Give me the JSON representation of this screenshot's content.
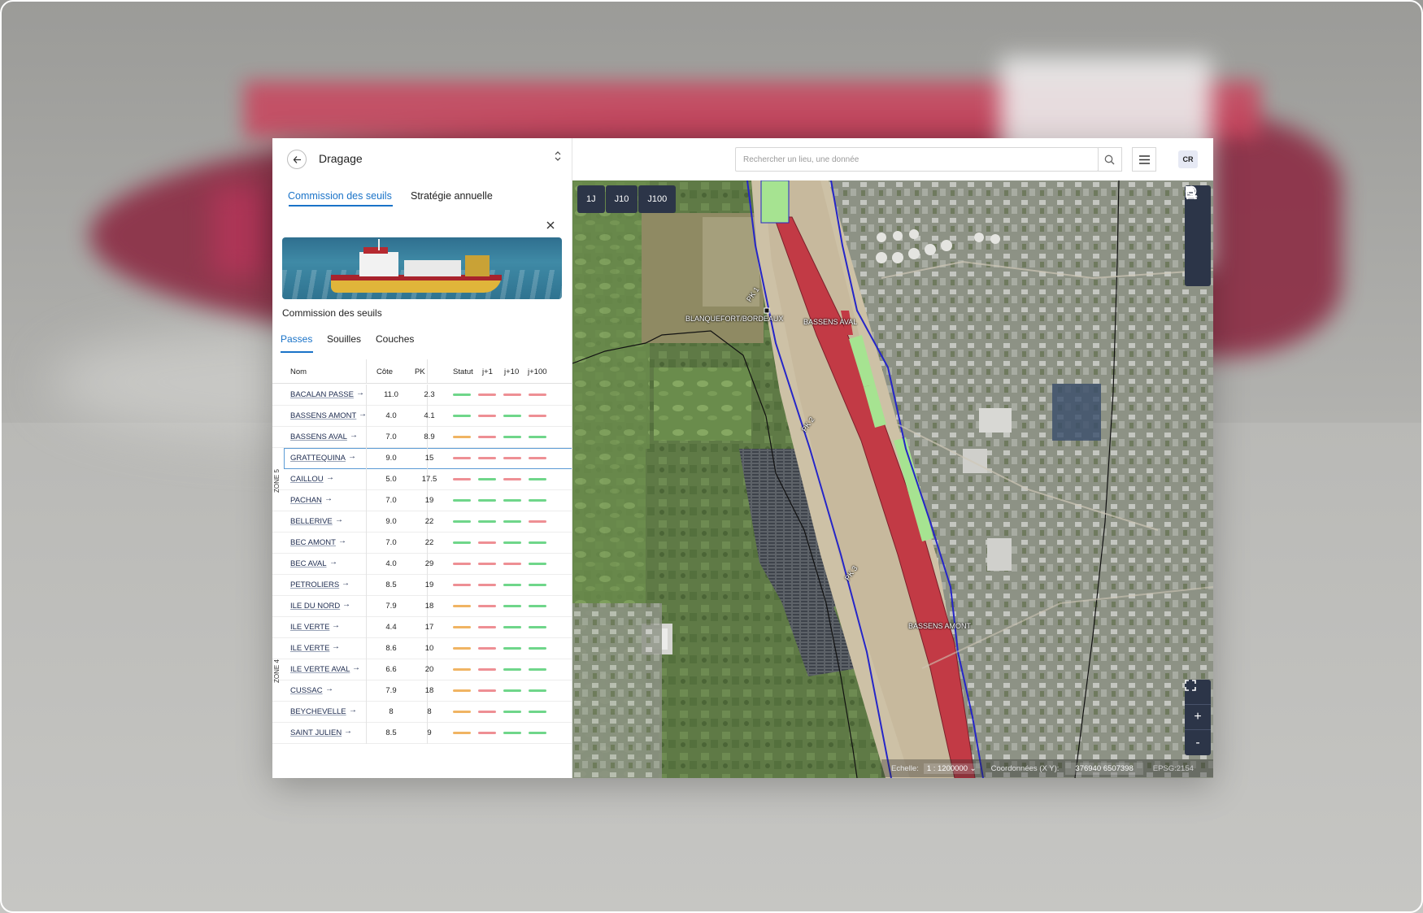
{
  "header": {
    "title": "Dragage",
    "back_icon": "arrow-left-icon"
  },
  "main_tabs": [
    {
      "label": "Commission des seuils",
      "active": true
    },
    {
      "label": "Stratégie annuelle",
      "active": false
    }
  ],
  "panel": {
    "caption": "Commission des seuils"
  },
  "sub_tabs": [
    {
      "label": "Passes",
      "active": true
    },
    {
      "label": "Souilles",
      "active": false
    },
    {
      "label": "Couches",
      "active": false
    }
  ],
  "table": {
    "headers": {
      "nom": "Nom",
      "cote": "Côte",
      "pk": "PK",
      "statut": "Statut",
      "j1": "j+1",
      "j10": "j+10",
      "j100": "j+100"
    },
    "zones": [
      "ZONE 5",
      "ZONE 4"
    ],
    "status_colors": {
      "green": "#6fd68a",
      "red": "#ee8f94",
      "orange": "#f0b463"
    },
    "rows": [
      {
        "name": "BACALAN PASSE",
        "cote": "11.0",
        "pk": "2.3",
        "status": [
          "green",
          "red",
          "red",
          "red"
        ]
      },
      {
        "name": "BASSENS AMONT",
        "cote": "4.0",
        "pk": "4.1",
        "status": [
          "green",
          "red",
          "green",
          "red"
        ]
      },
      {
        "name": "BASSENS AVAL",
        "cote": "7.0",
        "pk": "8.9",
        "status": [
          "orange",
          "red",
          "green",
          "green"
        ]
      },
      {
        "name": "GRATTEQUINA",
        "cote": "9.0",
        "pk": "15",
        "status": [
          "red",
          "red",
          "red",
          "red"
        ],
        "selected": true
      },
      {
        "name": "CAILLOU",
        "cote": "5.0",
        "pk": "17.5",
        "status": [
          "red",
          "green",
          "red",
          "green"
        ]
      },
      {
        "name": "PACHAN",
        "cote": "7.0",
        "pk": "19",
        "status": [
          "green",
          "green",
          "green",
          "green"
        ]
      },
      {
        "name": "BELLERIVE",
        "cote": "9.0",
        "pk": "22",
        "status": [
          "green",
          "green",
          "green",
          "red"
        ]
      },
      {
        "name": "BEC AMONT",
        "cote": "7.0",
        "pk": "22",
        "status": [
          "green",
          "red",
          "green",
          "green"
        ]
      },
      {
        "name": "BEC AVAL",
        "cote": "4.0",
        "pk": "29",
        "status": [
          "red",
          "red",
          "red",
          "green"
        ]
      },
      {
        "name": "PETROLIERS",
        "cote": "8.5",
        "pk": "19",
        "status": [
          "red",
          "red",
          "green",
          "green"
        ]
      },
      {
        "name": "ILE DU NORD",
        "cote": "7.9",
        "pk": "18",
        "status": [
          "orange",
          "red",
          "green",
          "green"
        ]
      },
      {
        "name": "ILE VERTE",
        "cote": "4.4",
        "pk": "17",
        "status": [
          "orange",
          "red",
          "green",
          "green"
        ]
      },
      {
        "name": "ILE VERTE",
        "cote": "8.6",
        "pk": "10",
        "status": [
          "orange",
          "red",
          "green",
          "green"
        ]
      },
      {
        "name": "ILE VERTE AVAL",
        "cote": "6.6",
        "pk": "20",
        "status": [
          "orange",
          "red",
          "green",
          "green"
        ]
      },
      {
        "name": "CUSSAC",
        "cote": "7.9",
        "pk": "18",
        "status": [
          "orange",
          "red",
          "green",
          "green"
        ]
      },
      {
        "name": "BEYCHEVELLE",
        "cote": "8",
        "pk": "8",
        "status": [
          "orange",
          "red",
          "green",
          "green"
        ]
      },
      {
        "name": "SAINT JULIEN",
        "cote": "8.5",
        "pk": "9",
        "status": [
          "orange",
          "red",
          "green",
          "green"
        ]
      }
    ]
  },
  "search": {
    "placeholder": "Rechercher un lieu, une donnée"
  },
  "user": {
    "initials": "CR"
  },
  "map": {
    "time_buttons": [
      "1J",
      "J10",
      "J100"
    ],
    "tools": [
      "compass-icon",
      "time-search-icon",
      "document-icon",
      "clock-stack-icon"
    ],
    "zoom_tools": [
      "fullscreen-icon",
      "zoom-in-icon",
      "zoom-out-icon"
    ],
    "zoom_in_label": "+",
    "zoom_out_label": "-",
    "scale_label": "Echelle:",
    "scale_value": "1 : 1200000",
    "coord_label": "Coordonnées (X Y):",
    "coord_value": "376940 6507398",
    "epsg": "EPSG:2154",
    "labels": {
      "blanquefort": "BLANQUEFORT/BORDEAUX",
      "bassens_aval": "BASSENS AVAL",
      "bassens_amont": "BASSENS AMONT",
      "pk1": "PK 1",
      "pk2": "PK 2",
      "pk3": "PK 3"
    },
    "channel_color": "#c23a45",
    "passes_color": "#a6e391",
    "border_color": "#2525c8"
  }
}
